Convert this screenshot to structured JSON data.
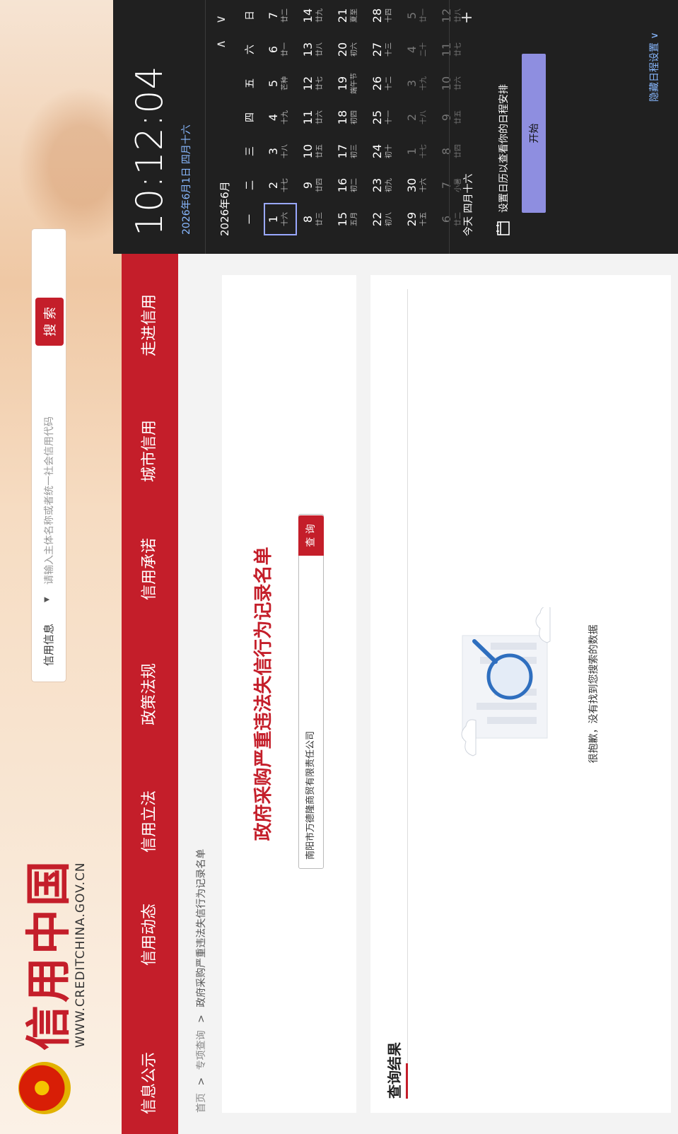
{
  "site": {
    "title": "信用中国",
    "url": "WWW.CREDITCHINA.GOV.CN"
  },
  "search": {
    "category": "信用信息",
    "placeholder": "请输入主体名称或者统一社会信用代码",
    "button": "搜 索"
  },
  "nav": [
    "信息公示",
    "信用动态",
    "信用立法",
    "政策法规",
    "信用承诺",
    "城市信用",
    "走进信用"
  ],
  "breadcrumb": [
    "首页",
    ">",
    "专项查询",
    ">",
    "政府采购严重违法失信行为记录名单"
  ],
  "query": {
    "title": "政府采购严重违法失信行为记录名单",
    "value": "南阳市万德隆商贸有限责任公司",
    "button": "查 询"
  },
  "results": {
    "title": "查询结果",
    "empty_text": "很抱歉，没有找到您搜索的数据"
  },
  "calendar": {
    "time": "10:12:04",
    "date": "2026年6月1日 四月十六",
    "month_label": "2026年6月",
    "weekdays": [
      "一",
      "二",
      "三",
      "四",
      "五",
      "六",
      "日"
    ],
    "weeks": [
      [
        [
          "1",
          "十六"
        ],
        [
          "2",
          "十七"
        ],
        [
          "3",
          "十八"
        ],
        [
          "4",
          "十九"
        ],
        [
          "5",
          "芒种"
        ],
        [
          "6",
          "廿一"
        ],
        [
          "7",
          "廿二"
        ]
      ],
      [
        [
          "8",
          "廿三"
        ],
        [
          "9",
          "廿四"
        ],
        [
          "10",
          "廿五"
        ],
        [
          "11",
          "廿六"
        ],
        [
          "12",
          "廿七"
        ],
        [
          "13",
          "廿八"
        ],
        [
          "14",
          "廿九"
        ]
      ],
      [
        [
          "15",
          "五月"
        ],
        [
          "16",
          "初二"
        ],
        [
          "17",
          "初三"
        ],
        [
          "18",
          "初四"
        ],
        [
          "19",
          "端午节"
        ],
        [
          "20",
          "初六"
        ],
        [
          "21",
          "夏至"
        ]
      ],
      [
        [
          "22",
          "初八"
        ],
        [
          "23",
          "初九"
        ],
        [
          "24",
          "初十"
        ],
        [
          "25",
          "十一"
        ],
        [
          "26",
          "十二"
        ],
        [
          "27",
          "十三"
        ],
        [
          "28",
          "十四"
        ]
      ],
      [
        [
          "29",
          "十五"
        ],
        [
          "30",
          "十六"
        ],
        [
          "1",
          "十七"
        ],
        [
          "2",
          "十八"
        ],
        [
          "3",
          "十九"
        ],
        [
          "4",
          "二十"
        ],
        [
          "5",
          "廿一"
        ]
      ],
      [
        [
          "6",
          "廿二"
        ],
        [
          "7",
          "小暑"
        ],
        [
          "8",
          "廿四"
        ],
        [
          "9",
          "廿五"
        ],
        [
          "10",
          "廿六"
        ],
        [
          "11",
          "廿七"
        ],
        [
          "12",
          "廿八"
        ]
      ]
    ],
    "today_label": "今天 四月十六",
    "hint": "设置日历以查看你的日程安排",
    "start_button": "开始",
    "hide_link": "隐藏日程设置 ∨",
    "plus": "+"
  },
  "colors": {
    "brand_red": "#c41e2a",
    "calendar_bg": "#202020",
    "accent_button": "#8e8ee0"
  }
}
